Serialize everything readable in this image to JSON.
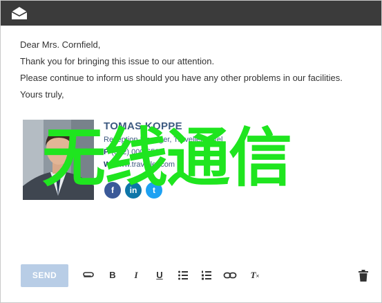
{
  "topbar": {
    "icon": "envelope-open-icon"
  },
  "email": {
    "lines": [
      "Dear Mrs. Cornfield,",
      "Thank you for bringing this issue to our attention.",
      "Please continue to inform us should you have any other problems in our facilities.",
      "Yours truly,"
    ]
  },
  "signature": {
    "name": "TOMAS KOPPE",
    "title": "Reception Manager, Traveller Hotel",
    "phone_prefix": "P",
    "phone": "(302) 000-6523",
    "web_prefix": "W",
    "web": "www.traveller.com",
    "socials": [
      "f",
      "in",
      "t"
    ]
  },
  "overlay": {
    "text": "无线通信"
  },
  "toolbar": {
    "send_label": "SEND",
    "bold_label": "B",
    "italic_label": "I",
    "underline_label": "U",
    "clear_format_label": "T"
  },
  "colors": {
    "topbar": "#3b3b3b",
    "send_button": "#b8cde6",
    "signature_text": "#3d5a80",
    "overlay_text": "#1fe51f"
  }
}
